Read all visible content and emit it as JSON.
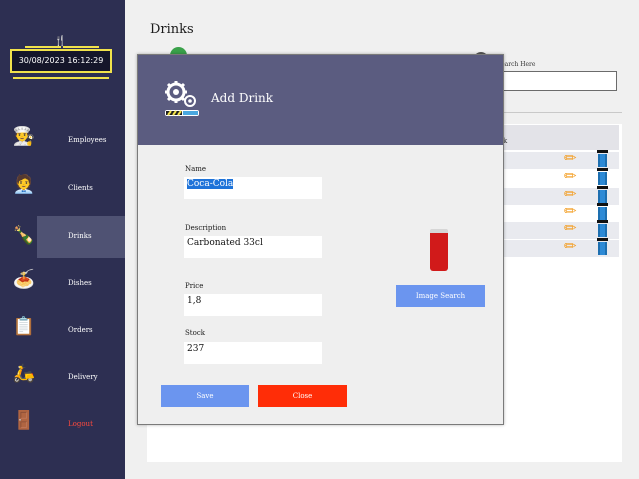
{
  "sidebar": {
    "datetime": "30/08/2023 16:12:29",
    "items": [
      {
        "label": "Employees",
        "icon": "chef-icon"
      },
      {
        "label": "Clients",
        "icon": "client-icon"
      },
      {
        "label": "Drinks",
        "icon": "bottle-icon",
        "active": true
      },
      {
        "label": "Dishes",
        "icon": "dish-icon"
      },
      {
        "label": "Orders",
        "icon": "clipboard-icon"
      },
      {
        "label": "Delivery",
        "icon": "scooter-icon"
      },
      {
        "label": "Logout",
        "icon": "exit-door-icon",
        "color": "#ff4a3d"
      }
    ]
  },
  "main": {
    "title": "Drinks",
    "search_label": "Search Here",
    "search_value": "",
    "table_header": "k"
  },
  "modal": {
    "title": "Add Drink",
    "fields": {
      "name": {
        "label": "Name",
        "value": "Coca-Cola"
      },
      "description": {
        "label": "Description",
        "value": "Carbonated 33cl"
      },
      "price": {
        "label": "Price",
        "value": "1,8"
      },
      "stock": {
        "label": "Stock",
        "value": "237"
      }
    },
    "image_search_label": "Image Search",
    "save_label": "Save",
    "close_label": "Close"
  },
  "colors": {
    "sidebar": "#2d2f52",
    "modal_header": "#5b5c80",
    "accent_gold": "#f1e24b",
    "button_blue": "#6b95ef",
    "button_close": "#ff2d07"
  }
}
